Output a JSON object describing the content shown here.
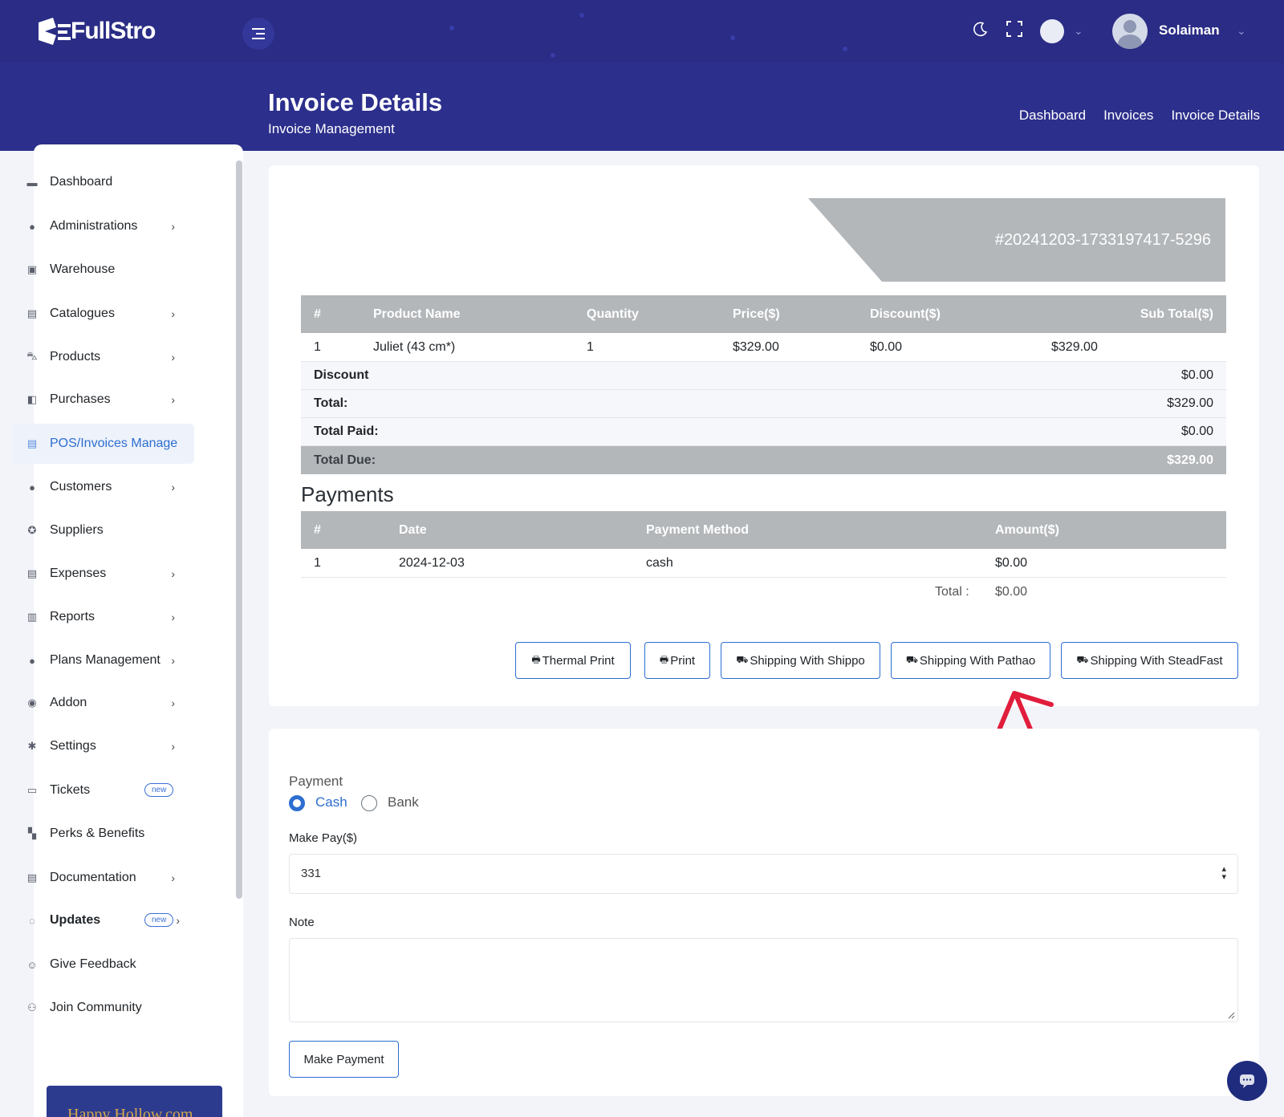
{
  "app": {
    "name": "FullStro",
    "user_name": "Solaiman"
  },
  "header": {
    "title": "Invoice Details",
    "subtitle": "Invoice Management",
    "breadcrumb": [
      "Dashboard",
      "Invoices",
      "Invoice Details"
    ]
  },
  "sidebar": {
    "items": [
      {
        "label": "Dashboard",
        "icon": "dashboard-icon",
        "has_arrow": false
      },
      {
        "label": "Administrations",
        "icon": "user-cog-icon",
        "has_arrow": true
      },
      {
        "label": "Warehouse",
        "icon": "warehouse-icon",
        "has_arrow": false
      },
      {
        "label": "Catalogues",
        "icon": "catalogue-icon",
        "has_arrow": true
      },
      {
        "label": "Products",
        "icon": "cart-icon",
        "has_arrow": true
      },
      {
        "label": "Purchases",
        "icon": "bag-icon",
        "has_arrow": true
      },
      {
        "label": "POS/Invoices Manage",
        "icon": "invoice-icon",
        "has_arrow": false,
        "active": true
      },
      {
        "label": "Customers",
        "icon": "customers-icon",
        "has_arrow": true
      },
      {
        "label": "Suppliers",
        "icon": "supplier-icon",
        "has_arrow": false
      },
      {
        "label": "Expenses",
        "icon": "expenses-icon",
        "has_arrow": true
      },
      {
        "label": "Reports",
        "icon": "report-icon",
        "has_arrow": true
      },
      {
        "label": "Plans Management",
        "icon": "plans-icon",
        "has_arrow": true
      },
      {
        "label": "Addon",
        "icon": "addon-icon",
        "has_arrow": true
      },
      {
        "label": "Settings",
        "icon": "gear-icon",
        "has_arrow": true
      },
      {
        "label": "Tickets",
        "icon": "ticket-icon",
        "has_arrow": false,
        "badge": "new"
      },
      {
        "label": "Perks & Benefits",
        "icon": "perks-icon",
        "has_arrow": false
      },
      {
        "label": "Documentation",
        "icon": "doc-icon",
        "has_arrow": true
      },
      {
        "label": "Updates",
        "icon": "updates-icon",
        "has_arrow": true,
        "badge": "new",
        "bold": true
      },
      {
        "label": "Give Feedback",
        "icon": "feedback-icon",
        "has_arrow": false
      },
      {
        "label": "Join Community",
        "icon": "community-icon",
        "has_arrow": false
      }
    ],
    "promo_text": "Happy Hollow.com"
  },
  "invoice": {
    "number": "#20241203-1733197417-5296",
    "columns": [
      "#",
      "Product Name",
      "Quantity",
      "Price($)",
      "Discount($)",
      "Sub Total($)"
    ],
    "rows": [
      {
        "index": "1",
        "product": "Juliet (43 cm*)",
        "quantity": "1",
        "price": "$329.00",
        "discount": "$0.00",
        "subtotal": "$329.00"
      }
    ],
    "summary": [
      {
        "label": "Discount",
        "value": "$0.00"
      },
      {
        "label": "Total:",
        "value": "$329.00"
      },
      {
        "label": "Total Paid:",
        "value": "$0.00"
      },
      {
        "label": "Total Due:",
        "value": "$329.00"
      }
    ]
  },
  "payments": {
    "title": "Payments",
    "columns": [
      "#",
      "Date",
      "Payment Method",
      "Amount($)"
    ],
    "rows": [
      {
        "index": "1",
        "date": "2024-12-03",
        "method": "cash",
        "amount": "$0.00"
      }
    ],
    "total_label": "Total :",
    "total_value": "$0.00"
  },
  "actions": {
    "thermal_print": "Thermal Print",
    "print": "Print",
    "shippo": "Shipping With Shippo",
    "pathao": "Shipping With Pathao",
    "steadfast": "Shipping With SteadFast"
  },
  "payment_form": {
    "payment_label": "Payment",
    "options": [
      "Cash",
      "Bank"
    ],
    "selected": "Cash",
    "make_pay_label": "Make Pay($)",
    "make_pay_value": "331",
    "note_label": "Note",
    "note_value": "",
    "submit_label": "Make Payment"
  },
  "colors": {
    "header_bg": "#2c2f8c",
    "accent": "#2d6ed0",
    "table_header": "#b3b7ba",
    "annotation_arrow": "#e11d3c"
  }
}
